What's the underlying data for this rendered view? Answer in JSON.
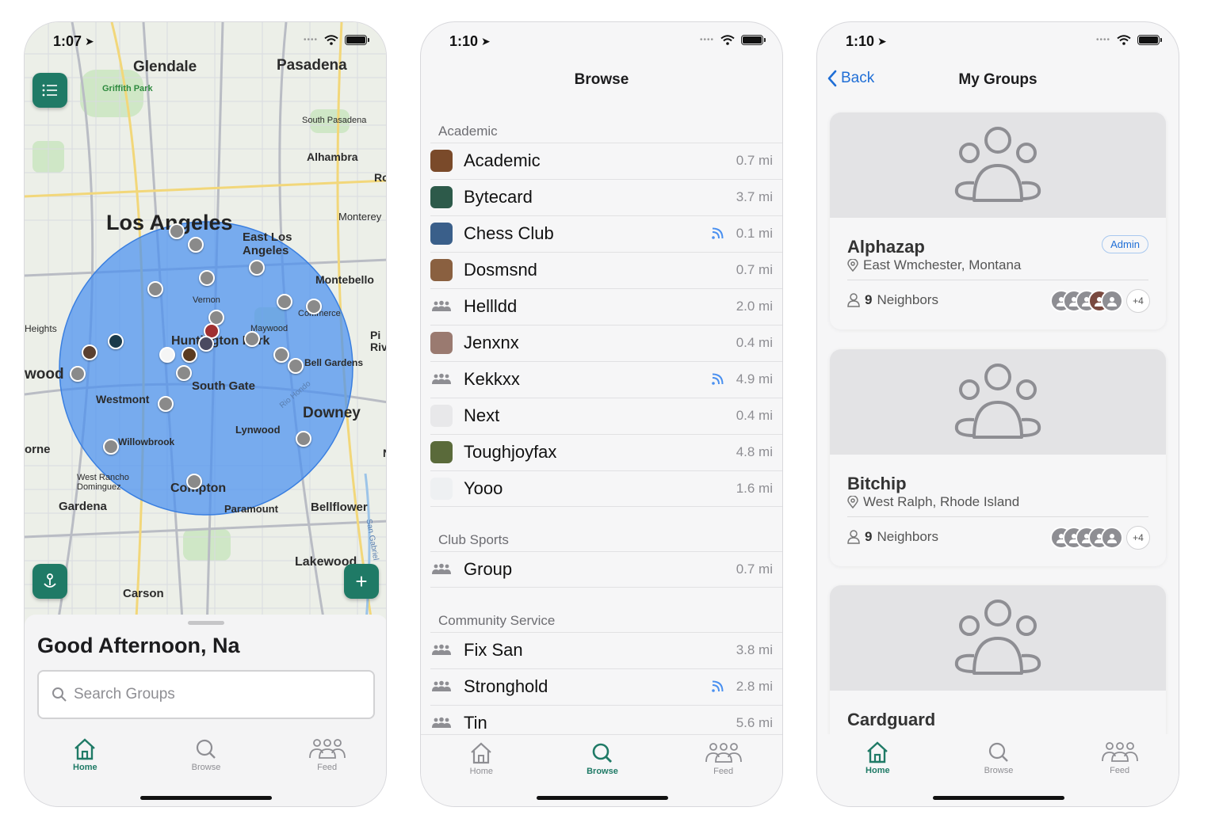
{
  "phones": [
    {
      "status_time": "1:07",
      "map": {
        "labels": {
          "glendale": "Glendale",
          "pasadena": "Pasadena",
          "griffith": "Griffith Park",
          "south_pasadena": "South Pasadena",
          "alhambra": "Alhambra",
          "ro": "Ro",
          "los_angeles": "Los Angeles",
          "monterey": "Monterey",
          "east_la": "East Los Angeles",
          "montebello": "Montebello",
          "vernon": "Vernon",
          "commerce": "Commerce",
          "heights": "Heights",
          "maywood": "Maywood",
          "huntington": "Huntington Park",
          "pico_rivera": "Pi Riv",
          "bell_gardens": "Bell Gardens",
          "wood": "wood",
          "south_gate": "South Gate",
          "westmont": "Westmont",
          "rio_hondo": "Rio Hondo",
          "downey": "Downey",
          "lynwood": "Lynwood",
          "willowbrook": "Willowbrook",
          "orne": "orne",
          "n": "N",
          "west_rancho": "West Rancho Dominguez",
          "compton": "Compton",
          "gardena": "Gardena",
          "paramount": "Paramount",
          "bellflower": "Bellflower",
          "san_gabriel": "San Gabriel",
          "lakewood": "Lakewood",
          "carson": "Carson"
        }
      },
      "greeting": "Good Afternoon, Na",
      "search_placeholder": "Search Groups",
      "active_tab": "home"
    },
    {
      "status_time": "1:10",
      "title": "Browse",
      "sections": [
        {
          "header": "Academic",
          "rows": [
            {
              "name": "Academic",
              "distance": "0.7 mi",
              "thumb": "#7a4a2a",
              "feed": false
            },
            {
              "name": "Bytecard",
              "distance": "3.7 mi",
              "thumb": "#2d5a4a",
              "feed": false
            },
            {
              "name": "Chess Club",
              "distance": "0.1 mi",
              "thumb": "#3a5f8a",
              "feed": true
            },
            {
              "name": "Dosmsnd",
              "distance": "0.7 mi",
              "thumb": "#8a6040",
              "feed": false
            },
            {
              "name": "Hellldd",
              "distance": "2.0 mi",
              "thumb": "people",
              "feed": false
            },
            {
              "name": "Jenxnx",
              "distance": "0.4 mi",
              "thumb": "#9a7a70",
              "feed": false
            },
            {
              "name": "Kekkxx",
              "distance": "4.9 mi",
              "thumb": "people",
              "feed": true
            },
            {
              "name": "Next",
              "distance": "0.4 mi",
              "thumb": "#e8e8ea",
              "feed": false
            },
            {
              "name": "Toughjoyfax",
              "distance": "4.8 mi",
              "thumb": "#5a6a3a",
              "feed": false
            },
            {
              "name": "Yooo",
              "distance": "1.6 mi",
              "thumb": "#eef0f2",
              "feed": false
            }
          ]
        },
        {
          "header": "Club Sports",
          "rows": [
            {
              "name": "Group",
              "distance": "0.7 mi",
              "thumb": "people",
              "feed": false
            }
          ]
        },
        {
          "header": "Community Service",
          "rows": [
            {
              "name": "Fix San",
              "distance": "3.8 mi",
              "thumb": "people",
              "feed": false
            },
            {
              "name": "Stronghold",
              "distance": "2.8 mi",
              "thumb": "people",
              "feed": true
            },
            {
              "name": "Tin",
              "distance": "5.6 mi",
              "thumb": "people",
              "feed": false
            }
          ]
        }
      ],
      "active_tab": "browse"
    },
    {
      "status_time": "1:10",
      "back_label": "Back",
      "title": "My Groups",
      "cards": [
        {
          "name": "Alphazap",
          "location": "East Wmchester, Montana",
          "members": "9",
          "members_label": "Neighbors",
          "more": "+4",
          "admin": "Admin"
        },
        {
          "name": "Bitchip",
          "location": "West Ralph, Rhode Island",
          "members": "9",
          "members_label": "Neighbors",
          "more": "+4",
          "admin": ""
        },
        {
          "name": "Cardguard",
          "location": "",
          "members": "",
          "members_label": "",
          "more": "",
          "admin": ""
        }
      ],
      "active_tab": "home"
    }
  ],
  "tabs": {
    "home": "Home",
    "browse": "Browse",
    "feed": "Feed"
  },
  "colors": {
    "accent": "#1f7a66",
    "link": "#1f6ed6",
    "radius_fill": "#4a90f0"
  }
}
